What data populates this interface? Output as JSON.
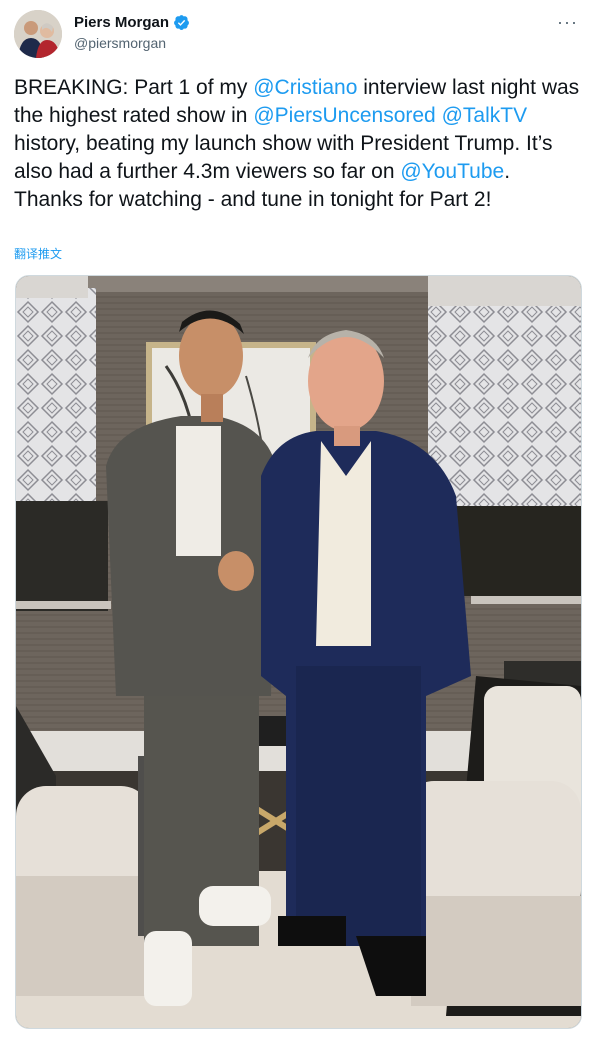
{
  "user": {
    "display_name": "Piers Morgan",
    "handle": "@piersmorgan",
    "verified_icon": "verified-badge-icon"
  },
  "more_icon": "more-dots-icon",
  "tweet": {
    "segments": [
      {
        "text": "BREAKING: Part 1 of my ",
        "type": "text"
      },
      {
        "text": "@Cristiano",
        "type": "mention"
      },
      {
        "text": " interview last night was the highest rated show in ",
        "type": "text"
      },
      {
        "text": "@PiersUncensored",
        "type": "mention"
      },
      {
        "text": " ",
        "type": "text"
      },
      {
        "text": "@TalkTV",
        "type": "mention"
      },
      {
        "text": " history, beating my launch show with President Trump. It’s also had a further 4.3m viewers so far on ",
        "type": "text"
      },
      {
        "text": "@YouTube",
        "type": "mention"
      },
      {
        "text": ". Thanks for watching - and tune in tonight for Part 2!",
        "type": "text"
      }
    ],
    "translate_label": "翻译推文"
  },
  "colors": {
    "link": "#1d9bf0",
    "text": "#0f1419",
    "secondary": "#536471"
  }
}
